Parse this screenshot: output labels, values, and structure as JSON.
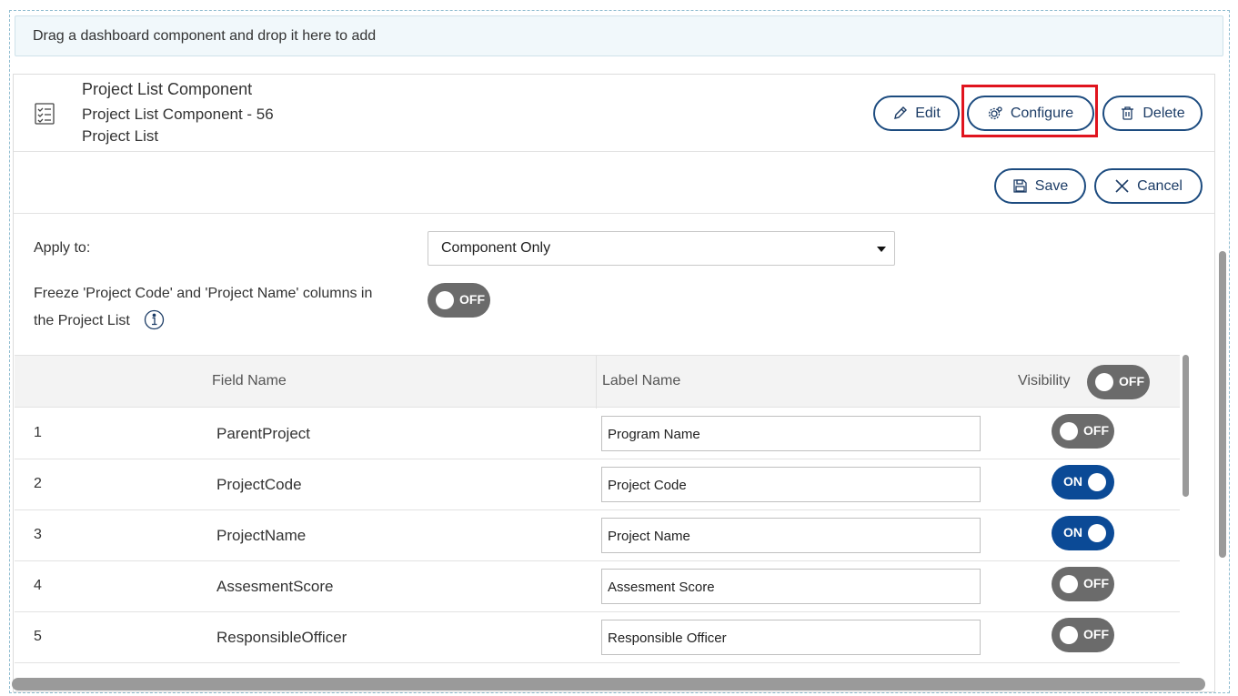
{
  "drop_zone": {
    "text": "Drag a dashboard component and drop it here to add"
  },
  "component": {
    "title": "Project List Component",
    "subtitle": "Project List Component - 56",
    "type": "Project List",
    "icon": "checklist-icon"
  },
  "actions": {
    "edit": "Edit",
    "configure": "Configure",
    "delete": "Delete"
  },
  "toolbar": {
    "save": "Save",
    "cancel": "Cancel"
  },
  "form": {
    "apply_to_label": "Apply to:",
    "apply_to_value": "Component Only",
    "freeze_label_line1": "Freeze 'Project Code' and 'Project Name' columns in",
    "freeze_label_line2": "the Project List",
    "freeze_toggle": "OFF"
  },
  "table": {
    "headers": {
      "field": "Field Name",
      "label": "Label Name",
      "visibility": "Visibility"
    },
    "visibility_all": "OFF",
    "rows": [
      {
        "num": "1",
        "field": "ParentProject",
        "label": "Program Name",
        "visible": "OFF"
      },
      {
        "num": "2",
        "field": "ProjectCode",
        "label": "Project Code",
        "visible": "ON"
      },
      {
        "num": "3",
        "field": "ProjectName",
        "label": "Project Name",
        "visible": "ON"
      },
      {
        "num": "4",
        "field": "AssesmentScore",
        "label": "Assesment Score",
        "visible": "OFF"
      },
      {
        "num": "5",
        "field": "ResponsibleOfficer",
        "label": "Responsible Officer",
        "visible": "OFF"
      }
    ]
  },
  "colors": {
    "accent": "#1c4b7f",
    "toggle_on": "#0b4a96",
    "toggle_off": "#6b6b6b",
    "highlight": "#e0141e"
  }
}
